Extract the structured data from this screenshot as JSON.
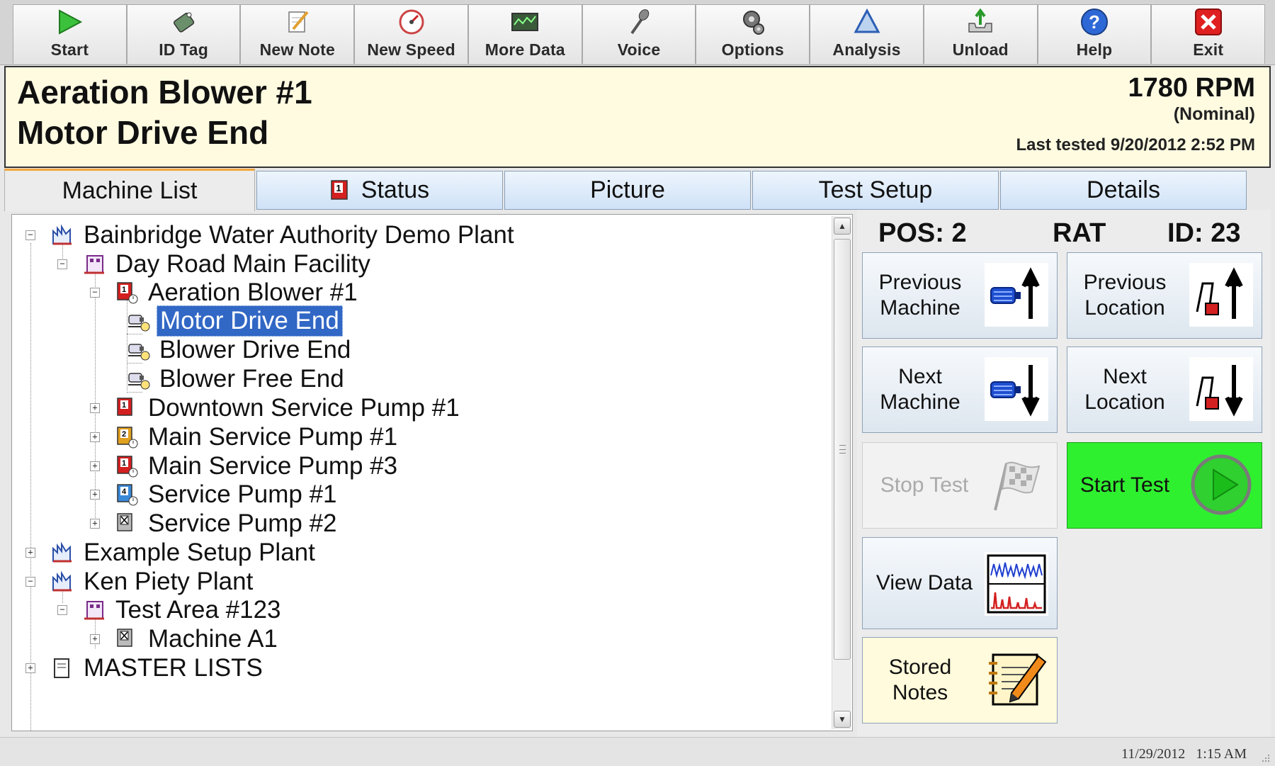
{
  "toolbar": {
    "buttons": [
      {
        "label": "Start",
        "icon": "play-icon"
      },
      {
        "label": "ID Tag",
        "icon": "tag-icon"
      },
      {
        "label": "New Note",
        "icon": "note-icon"
      },
      {
        "label": "New Speed",
        "icon": "speedometer-icon"
      },
      {
        "label": "More Data",
        "icon": "data-screen-icon"
      },
      {
        "label": "Voice",
        "icon": "microphone-icon"
      },
      {
        "label": "Options",
        "icon": "gears-icon"
      },
      {
        "label": "Analysis",
        "icon": "analysis-triangle-icon"
      },
      {
        "label": "Unload",
        "icon": "unload-tray-icon"
      },
      {
        "label": "Help",
        "icon": "help-icon"
      },
      {
        "label": "Exit",
        "icon": "exit-icon"
      }
    ]
  },
  "header": {
    "machine": "Aeration Blower #1",
    "location": "Motor Drive End",
    "rpm": "1780 RPM",
    "rpm_note": "(Nominal)",
    "last_tested": "Last tested 9/20/2012 2:52 PM"
  },
  "tabs": [
    {
      "label": "Machine List",
      "active": true
    },
    {
      "label": "Status",
      "active": false
    },
    {
      "label": "Picture",
      "active": false
    },
    {
      "label": "Test Setup",
      "active": false
    },
    {
      "label": "Details",
      "active": false
    }
  ],
  "tree": [
    {
      "label": "Bainbridge Water Authority Demo Plant",
      "level": 0,
      "expander": "minus",
      "icon": "plant-icon"
    },
    {
      "label": "Day Road Main Facility",
      "level": 1,
      "expander": "minus",
      "icon": "facility-icon"
    },
    {
      "label": "Aeration Blower #1",
      "level": 2,
      "expander": "minus",
      "icon": "machine-priority-1-icon"
    },
    {
      "label": "Motor Drive End",
      "level": 3,
      "expander": "",
      "icon": "location-sensor-icon",
      "selected": true
    },
    {
      "label": "Blower Drive End",
      "level": 3,
      "expander": "",
      "icon": "location-sensor-icon"
    },
    {
      "label": "Blower Free End",
      "level": 3,
      "expander": "",
      "icon": "location-sensor-icon"
    },
    {
      "label": "Downtown Service Pump #1",
      "level": 2,
      "expander": "plus",
      "icon": "machine-priority-1-icon"
    },
    {
      "label": "Main Service Pump #1",
      "level": 2,
      "expander": "plus",
      "icon": "machine-priority-2-icon"
    },
    {
      "label": "Main Service Pump #3",
      "level": 2,
      "expander": "plus",
      "icon": "machine-priority-1-icon"
    },
    {
      "label": "Service Pump #1",
      "level": 2,
      "expander": "plus",
      "icon": "machine-priority-4-icon"
    },
    {
      "label": "Service Pump #2",
      "level": 2,
      "expander": "plus",
      "icon": "machine-excluded-icon"
    },
    {
      "label": "Example Setup Plant",
      "level": 0,
      "expander": "plus",
      "icon": "plant-icon"
    },
    {
      "label": "Ken Piety Plant",
      "level": 0,
      "expander": "minus",
      "icon": "plant-icon"
    },
    {
      "label": "Test Area #123",
      "level": 1,
      "expander": "minus",
      "icon": "facility-icon"
    },
    {
      "label": "Machine A1",
      "level": 2,
      "expander": "plus",
      "icon": "machine-excluded-icon"
    },
    {
      "label": "MASTER LISTS",
      "level": 0,
      "expander": "plus",
      "icon": "document-icon"
    }
  ],
  "info": {
    "pos": "POS: 2",
    "rat": "RAT",
    "id": "ID: 23"
  },
  "actions": {
    "prev_machine": "Previous Machine",
    "prev_location": "Previous Location",
    "next_machine": "Next Machine",
    "next_location": "Next Location",
    "stop_test": "Stop Test",
    "start_test": "Start Test",
    "view_data": "View Data",
    "stored_notes": "Stored Notes"
  },
  "colors": {
    "header_bg": "#fffbe1",
    "selected_bg": "#3167c5",
    "start_green": "#2ff02f",
    "tab_accent": "#f1a73b"
  },
  "statusbar": {
    "datetime": "11/29/2012   1:15 AM"
  }
}
